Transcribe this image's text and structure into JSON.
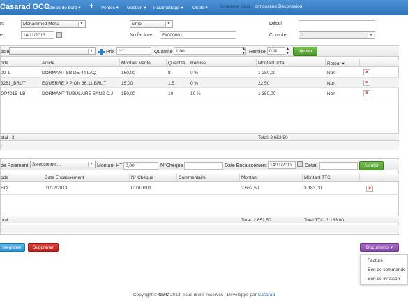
{
  "navbar": {
    "brand": "Casarad GCC",
    "items": [
      "Tableau de bord ▾",
      "Ventes ▾",
      "Gestion ▾",
      "Paramétrage ▾",
      "Outils ▾"
    ],
    "plus": "+",
    "connected_label": "Connecté sous :",
    "user": "simossene",
    "logout": "Deconexion"
  },
  "header_form": {
    "client_label": "nt",
    "client_value": "Mohammed Moha",
    "date_label": "e",
    "date_value": "14/11/2013",
    "agent_value": "simo",
    "invoice_label": "No facture",
    "invoice_value": "FA000001",
    "detail_label": "Détail",
    "detail_value": "",
    "account_label": "Compte",
    "account_value": "0"
  },
  "article_toolbar": {
    "article_label": "ticle",
    "article_value": "",
    "prix_label": "Prix",
    "prix_placeholder": "HT",
    "quantite_label": "Quantité",
    "quantite_value": "1,00",
    "remise_label": "Remise",
    "remise_value": "0 %",
    "add_button": "Ajouter"
  },
  "articles_table": {
    "headers": [
      "ode",
      "Article",
      "Montant Vente",
      "Quantité",
      "Remise",
      "Montant Total",
      "Retour ▾"
    ],
    "rows": [
      {
        "code": "00_L",
        "article": "DORMANT SB DE 44 LAQ",
        "vente": "160,00",
        "quantite": "8",
        "remise": "0 %",
        "total": "1 280,00",
        "retour": "Non"
      },
      {
        "code": "3281_BRUT",
        "article": "EQUERRE A PION 36.11 BRUT",
        "vente": "15,00",
        "quantite": "1.5",
        "remise": "0 %",
        "total": "22,50",
        "retour": "Non"
      },
      {
        "code": "OP4015_LB",
        "article": "DORMANT TUBULAIRE SANS C.J",
        "vente": "150,00",
        "quantite": "10",
        "remise": "10 %",
        "total": "1 350,00",
        "retour": "Non"
      }
    ],
    "footer_left": "otal : 3",
    "footer_total": "Total: 2 652,50"
  },
  "payment_toolbar": {
    "mode_label": "de Paiement",
    "mode_value": "Selectionner...",
    "montant_label": "Montant HT",
    "montant_value": "0,00",
    "cheque_label": "N°Chèque",
    "cheque_value": "",
    "date_label": "Date Encaissement",
    "date_value": "14/11/2013",
    "detail_label": "Detail",
    "detail_value": "",
    "add_button": "Ajouter"
  },
  "payments_table": {
    "headers": [
      "ode",
      "Date Encaissement",
      "N° Chèque",
      "Commentaire",
      "Montant",
      "Montant TTC"
    ],
    "rows": [
      {
        "code": "HQ",
        "date": "01/12/2013",
        "cheque": "01010101",
        "commentaire": "",
        "montant": "2 652,50",
        "ttc": "3 183,00"
      }
    ],
    "footer_left": "otal : 1",
    "footer_total": "Total: 2 652,50",
    "footer_ttc": "Total TTC: 3 183,00"
  },
  "actions": {
    "save": "nregistrer",
    "delete": "Supprimer",
    "documents": "Documents ▾"
  },
  "documents_menu": [
    "Facture",
    "Bon de commande",
    "Bon de livraison"
  ],
  "footer": {
    "prefix": "Copyright ©",
    "company": "GMC",
    "middle": "2013, Tous droits réservés | Développé par",
    "link": "Casarad"
  },
  "colors": {
    "navbar": "#3a82c7",
    "green": "#5fae3a",
    "red": "#c9302c",
    "purple": "#9b5fbb",
    "blue": "#3a9ad9"
  }
}
